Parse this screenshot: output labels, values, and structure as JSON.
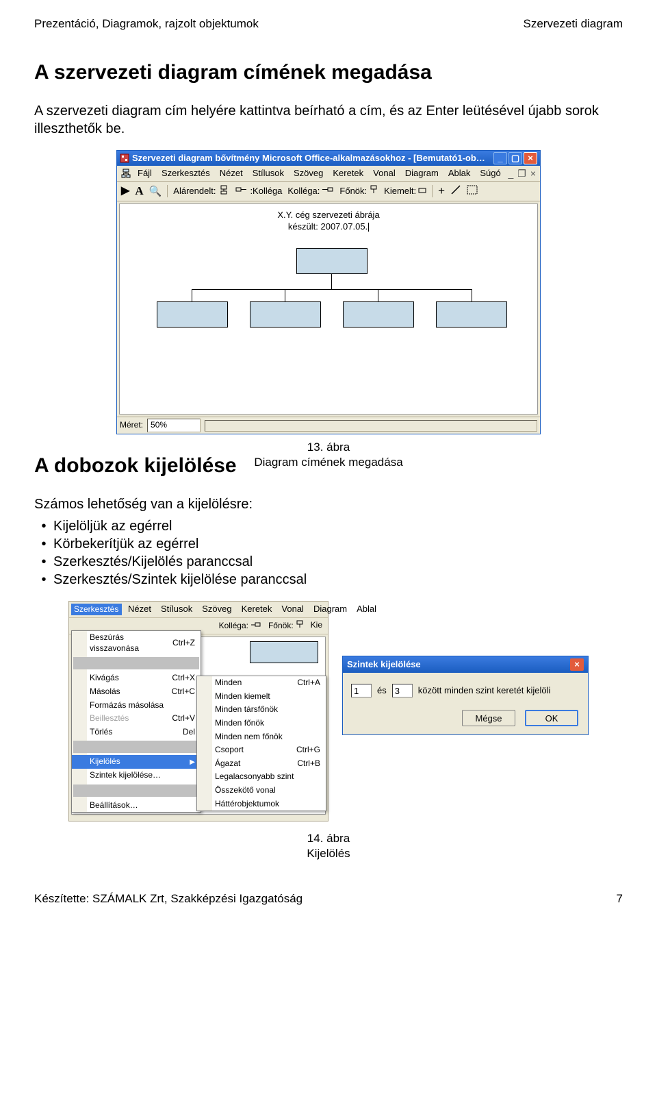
{
  "header": {
    "left": "Prezentáció, Diagramok, rajzolt objektumok",
    "right": "Szervezeti diagram"
  },
  "section1_title": "A szervezeti diagram címének megadása",
  "section1_para": "A szervezeti diagram cím helyére kattintva beírható a cím, és az Enter leütésével újabb sorok illeszthetők be.",
  "fig13": {
    "num": "13. ábra",
    "caption": "Diagram címének megadása"
  },
  "section2_title": "A dobozok kijelölése",
  "section2_intro": "Számos lehetőség van a kijelölésre:",
  "bullets": [
    "Kijelöljük az egérrel",
    "Körbekerítjük az egérrel",
    "Szerkesztés/Kijelölés paranccsal",
    "Szerkesztés/Szintek kijelölése paranccsal"
  ],
  "fig14": {
    "num": "14. ábra",
    "caption": "Kijelölés"
  },
  "win": {
    "title": "Szervezeti diagram bővítmény Microsoft Office-alkalmazásokhoz - [Bemutató1-ob…",
    "menus": [
      "Fájl",
      "Szerkesztés",
      "Nézet",
      "Stílusok",
      "Szöveg",
      "Keretek",
      "Vonal",
      "Diagram",
      "Ablak",
      "Súgó"
    ],
    "tool_labels": {
      "alarendelt": "Alárendelt:",
      "kollega_pre": ":Kolléga",
      "kollega": "Kolléga:",
      "fonok": "Főnök:",
      "kiemelt": "Kiemelt:"
    },
    "chart_title_line1": "X.Y. cég szervezeti ábrája",
    "chart_title_line2": "készült: 2007.07.05.",
    "status_label": "Méret:",
    "status_value": "50%"
  },
  "menu2": {
    "highlight_tab": "Szerkesztés",
    "menubar": [
      "Nézet",
      "Stílusok",
      "Szöveg",
      "Keretek",
      "Vonal",
      "Diagram",
      "Ablal"
    ],
    "tool2": {
      "kollega": "Kolléga:",
      "fonok": "Főnök:",
      "kie": "Kie"
    },
    "dropdown": [
      {
        "label": "Beszúrás visszavonása",
        "shortcut": "Ctrl+Z"
      },
      {
        "sep": true
      },
      {
        "label": "Kivágás",
        "shortcut": "Ctrl+X"
      },
      {
        "label": "Másolás",
        "shortcut": "Ctrl+C"
      },
      {
        "label": "Formázás másolása"
      },
      {
        "label": "Beillesztés",
        "shortcut": "Ctrl+V",
        "disabled": true
      },
      {
        "label": "Törlés",
        "shortcut": "Del"
      },
      {
        "sep": true
      },
      {
        "label": "Kijelölés",
        "sub": true,
        "hl": true
      },
      {
        "label": "Szintek kijelölése…"
      },
      {
        "sep": true
      },
      {
        "label": "Beállítások…"
      }
    ],
    "submenu": [
      {
        "label": "Minden",
        "shortcut": "Ctrl+A"
      },
      {
        "label": "Minden kiemelt"
      },
      {
        "label": "Minden társfőnök"
      },
      {
        "label": "Minden főnök"
      },
      {
        "label": "Minden nem főnök"
      },
      {
        "label": "Csoport",
        "shortcut": "Ctrl+G"
      },
      {
        "label": "Ágazat",
        "shortcut": "Ctrl+B"
      },
      {
        "label": "Legalacsonyabb szint"
      },
      {
        "label": "Összekötő vonal"
      },
      {
        "label": "Háttérobjektumok"
      }
    ]
  },
  "dialog": {
    "title": "Szintek kijelölése",
    "field1": "1",
    "between": "és",
    "field2": "3",
    "rest": "között minden szint keretét kijelöli",
    "cancel": "Mégse",
    "ok": "OK"
  },
  "footer": {
    "left": "Készítette: SZÁMALK Zrt, Szakképzési Igazgatóság",
    "page": "7"
  }
}
